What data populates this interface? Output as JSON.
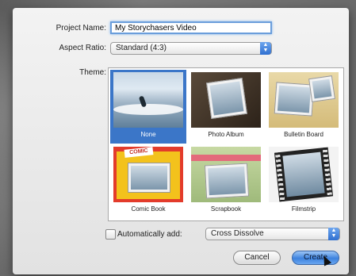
{
  "form": {
    "project_name_label": "Project Name:",
    "project_name_value": "My Storychasers Video",
    "aspect_ratio_label": "Aspect Ratio:",
    "aspect_ratio_value": "Standard (4:3)",
    "theme_label": "Theme:"
  },
  "themes": [
    {
      "name": "None",
      "selected": true
    },
    {
      "name": "Photo Album",
      "selected": false
    },
    {
      "name": "Bulletin Board",
      "selected": false
    },
    {
      "name": "Comic Book",
      "selected": false
    },
    {
      "name": "Scrapbook",
      "selected": false
    },
    {
      "name": "Filmstrip",
      "selected": false
    }
  ],
  "comic_banner": "COMIC",
  "auto_add": {
    "label": "Automatically add:",
    "checked": false,
    "value": "Cross Dissolve"
  },
  "buttons": {
    "cancel": "Cancel",
    "create": "Create"
  },
  "colors": {
    "selection": "#3b76c8",
    "accent_blue": "#3d82de"
  },
  "icons": [
    "popup-arrows-icon",
    "mouse-cursor-icon"
  ]
}
